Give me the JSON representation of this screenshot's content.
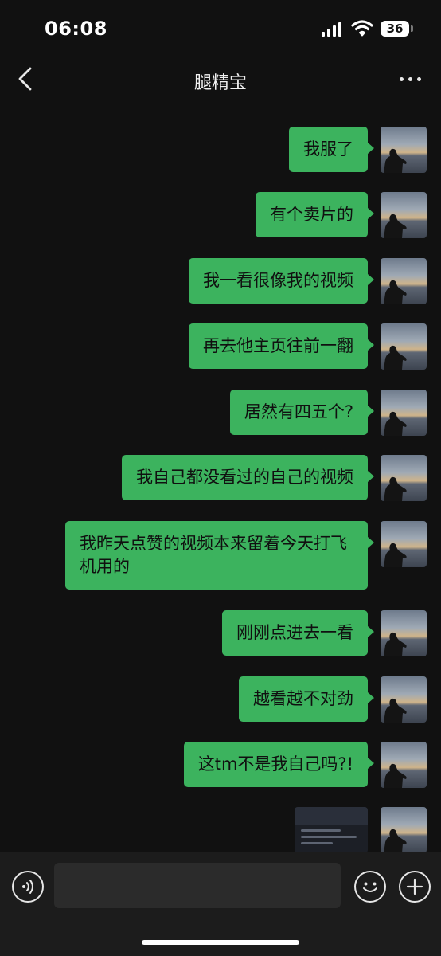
{
  "status_bar": {
    "time": "06:08",
    "battery": "36"
  },
  "nav": {
    "title": "腿精宝"
  },
  "messages": [
    {
      "text": "我服了"
    },
    {
      "text": "有个卖片的"
    },
    {
      "text": "我一看很像我的视频"
    },
    {
      "text": "再去他主页往前一翻"
    },
    {
      "text": "居然有四五个?"
    },
    {
      "text": "我自己都没看过的自己的视频"
    },
    {
      "text": "我昨天点赞的视频本来留着今天打飞机用的"
    },
    {
      "text": "刚刚点进去一看"
    },
    {
      "text": "越看越不对劲"
    },
    {
      "text": "这tm不是我自己吗?!"
    }
  ],
  "icons": {
    "back": "chevron-left-icon",
    "more": "more-dots-icon",
    "voice": "voice-icon",
    "emoji": "emoji-icon",
    "add": "plus-icon"
  },
  "colors": {
    "bubble": "#3cb35e",
    "background": "#111111",
    "input_bar": "#1c1c1c"
  }
}
